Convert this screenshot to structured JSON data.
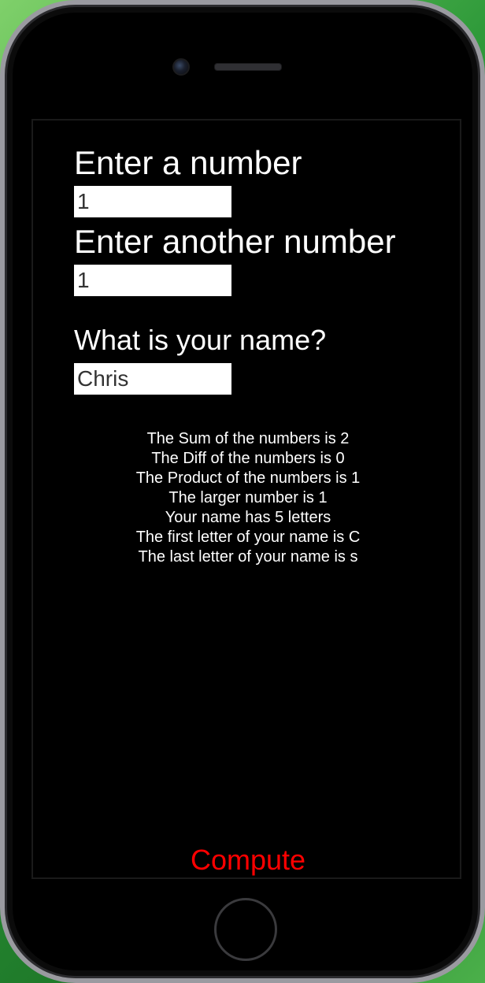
{
  "form": {
    "first_label": "Enter a number",
    "first_value": "1",
    "second_label": "Enter another number",
    "second_value": "1",
    "name_label": "What is your name?",
    "name_value": "Chris"
  },
  "results": [
    "The Sum of the numbers is 2",
    "The Diff of the numbers is 0",
    "The Product of the numbers is 1",
    "The larger number is 1",
    "Your name has 5 letters",
    "The first letter of your name is C",
    "The last letter of your name is s"
  ],
  "compute_label": "Compute",
  "colors": {
    "background": "#000000",
    "text": "#ffffff",
    "input_bg": "#ffffff",
    "accent": "#ff0000"
  }
}
